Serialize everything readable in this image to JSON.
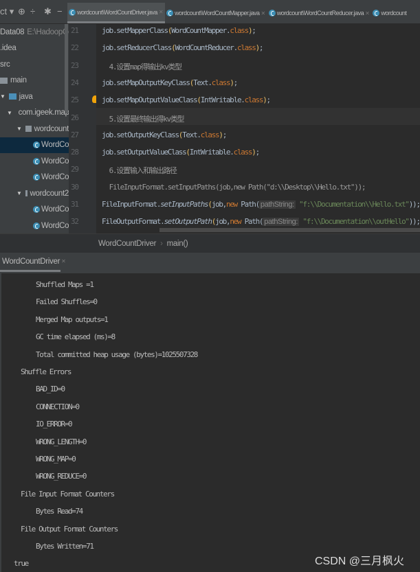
{
  "toolbar": {
    "project_label": "ct",
    "dropdown_icon": "triangle-down-icon",
    "icons": [
      "target-icon",
      "collapse-icon",
      "gear-icon",
      "minus-icon"
    ]
  },
  "tabs": [
    {
      "label": "wordcount\\WordCountDriver.java",
      "active": true
    },
    {
      "label": "wordcount\\WordCountMapper.java",
      "active": false
    },
    {
      "label": "wordcount\\WordCountReducer.java",
      "active": false
    },
    {
      "label": "wordcount",
      "active": false
    }
  ],
  "tree": [
    {
      "label": "Data08",
      "extra": "E:\\HadoopCodes\\b",
      "indent": 0
    },
    {
      "label": ".idea",
      "indent": 0
    },
    {
      "label": "src",
      "indent": 0
    },
    {
      "label": "main",
      "indent": 0,
      "folder": true
    },
    {
      "label": "java",
      "indent": 0,
      "folder": true,
      "blue": true,
      "arrow": true
    },
    {
      "label": "com.igeek.mapre",
      "indent": 10,
      "folder": true,
      "arrow": true
    },
    {
      "label": "wordcount",
      "indent": 24,
      "folder": true,
      "arrow": true
    },
    {
      "label": "WordCountDriver",
      "indent": 46,
      "file": true,
      "selected": true
    },
    {
      "label": "WordCountMapper",
      "indent": 46,
      "file": true
    },
    {
      "label": "WordCountReducer",
      "indent": 46,
      "file": true
    },
    {
      "label": "wordcount2",
      "indent": 24,
      "folder": true,
      "arrow": true
    },
    {
      "label": "WordCountDriver",
      "indent": 46,
      "file": true
    },
    {
      "label": "WordCountMapper",
      "indent": 46,
      "file": true
    },
    {
      "label": "WordCountReducer",
      "indent": 46,
      "file": true
    }
  ],
  "code": [
    {
      "n": "21",
      "tokens": [
        [
          "p",
          "job.setMapperClass"
        ],
        [
          "paren",
          "("
        ],
        [
          "p",
          "WordCountMapper."
        ],
        [
          "kw",
          "class"
        ],
        [
          "paren",
          ")"
        ],
        [
          "p",
          ";"
        ]
      ]
    },
    {
      "n": "22",
      "tokens": [
        [
          "p",
          "job.setReducerClass"
        ],
        [
          "paren",
          "("
        ],
        [
          "p",
          "WordCountReducer."
        ],
        [
          "kw",
          "class"
        ],
        [
          "paren",
          ")"
        ],
        [
          "p",
          ";"
        ]
      ]
    },
    {
      "n": "23",
      "tokens": [
        [
          "cm",
          "  4.设置map得输出kv类型"
        ]
      ]
    },
    {
      "n": "24",
      "tokens": [
        [
          "p",
          "job.setMapOutputKeyClass"
        ],
        [
          "paren",
          "("
        ],
        [
          "p",
          "Text."
        ],
        [
          "kw",
          "class"
        ],
        [
          "paren",
          ")"
        ],
        [
          "p",
          ";"
        ]
      ]
    },
    {
      "n": "25",
      "tokens": [
        [
          "p",
          "job.setMapOutputValueClass"
        ],
        [
          "paren",
          "("
        ],
        [
          "p",
          "IntWritable."
        ],
        [
          "kw",
          "class"
        ],
        [
          "paren",
          ")"
        ],
        [
          "p",
          ";"
        ]
      ]
    },
    {
      "n": "26",
      "tokens": [
        [
          "cm",
          "  5.设置最终输出得kv类型"
        ]
      ]
    },
    {
      "n": "27",
      "tokens": [
        [
          "p",
          "job.setOutputKeyClass"
        ],
        [
          "paren",
          "("
        ],
        [
          "p",
          "Text."
        ],
        [
          "kw",
          "class"
        ],
        [
          "paren",
          ")"
        ],
        [
          "p",
          ";"
        ]
      ]
    },
    {
      "n": "28",
      "tokens": [
        [
          "p",
          "job.setOutputValueClass"
        ],
        [
          "paren",
          "("
        ],
        [
          "p",
          "IntWritable."
        ],
        [
          "kw",
          "class"
        ],
        [
          "paren",
          ")"
        ],
        [
          "p",
          ";"
        ]
      ]
    },
    {
      "n": "29",
      "tokens": [
        [
          "cm",
          "  6.设置输入和输出路径"
        ]
      ]
    },
    {
      "n": "30",
      "tokens": [
        [
          "cm",
          "  FileInputFormat.setInputPaths(job,new Path(\"d:\\\\Desktop\\\\Hello.txt\"));"
        ]
      ]
    },
    {
      "n": "31",
      "tokens": [
        [
          "p",
          "FileInputFormat."
        ],
        [
          "it",
          "setInputPaths"
        ],
        [
          "paren",
          "("
        ],
        [
          "p",
          "job,"
        ],
        [
          "kw",
          "new "
        ],
        [
          "p",
          "Path("
        ],
        [
          "hint",
          "pathString:"
        ],
        [
          "str",
          " \"f:\\\\Documentation\\\\Hello.txt\""
        ],
        [
          "p",
          "))"
        ],
        [
          "p",
          ";"
        ]
      ]
    },
    {
      "n": "32",
      "tokens": [
        [
          "p",
          "FileOutputFormat."
        ],
        [
          "it",
          "setOutputPath"
        ],
        [
          "paren",
          "("
        ],
        [
          "p",
          "job,"
        ],
        [
          "kw",
          "new "
        ],
        [
          "p",
          "Path("
        ],
        [
          "hint",
          "pathString:"
        ],
        [
          "str",
          " \"f:\\\\Documentation\\\\outHello\""
        ],
        [
          "p",
          "))"
        ],
        [
          "p",
          ";"
        ]
      ]
    }
  ],
  "breadcrumb": {
    "class": "WordCountDriver",
    "method": "main()"
  },
  "run_tab": {
    "label": "WordCountDriver"
  },
  "console": [
    {
      "text": "Shuffled Maps =1",
      "level": 2
    },
    {
      "text": "Failed Shuffles=0",
      "level": 2
    },
    {
      "text": "Merged Map outputs=1",
      "level": 2
    },
    {
      "text": "GC time elapsed (ms)=8",
      "level": 2
    },
    {
      "text": "Total committed heap usage (bytes)=1025507328",
      "level": 2
    },
    {
      "text": "Shuffle Errors",
      "level": 1
    },
    {
      "text": "BAD_ID=0",
      "level": 2
    },
    {
      "text": "CONNECTION=0",
      "level": 2
    },
    {
      "text": "IO_ERROR=0",
      "level": 2
    },
    {
      "text": "WRONG_LENGTH=0",
      "level": 2
    },
    {
      "text": "WRONG_MAP=0",
      "level": 2
    },
    {
      "text": "WRONG_REDUCE=0",
      "level": 2
    },
    {
      "text": "File Input Format Counters",
      "level": 1
    },
    {
      "text": "Bytes Read=74",
      "level": 2
    },
    {
      "text": "File Output Format Counters",
      "level": 1
    },
    {
      "text": "Bytes Written=71",
      "level": 2
    },
    {
      "text": "true",
      "level": 0
    }
  ],
  "watermark": "CSDN @三月枫火"
}
